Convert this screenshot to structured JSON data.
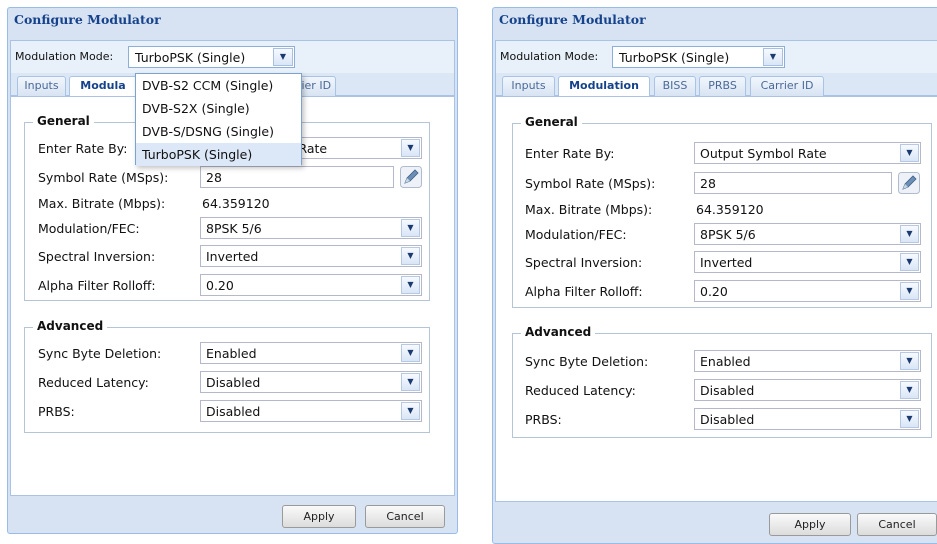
{
  "left": {
    "title": "Configure Modulator",
    "mode_label": "Modulation Mode:",
    "mode_value": "TurboPSK (Single)",
    "tabs": [
      {
        "label": "Inputs"
      },
      {
        "label": "Modula"
      },
      {
        "label": "rier ID"
      }
    ],
    "dropdown_options": [
      "DVB-S2 CCM (Single)",
      "DVB-S2X (Single)",
      "DVB-S/DSNG (Single)",
      "TurboPSK (Single)"
    ],
    "general_legend": "General",
    "enter_rate_label": "Enter Rate By:",
    "enter_rate_value": "l Rate",
    "symbol_rate_label": "Symbol Rate (MSps):",
    "symbol_rate_value": "28",
    "max_bitrate_label": "Max. Bitrate (Mbps):",
    "max_bitrate_value": "64.359120",
    "modfec_label": "Modulation/FEC:",
    "modfec_value": "8PSK 5/6",
    "spectral_label": "Spectral Inversion:",
    "spectral_value": "Inverted",
    "alpha_label": "Alpha Filter Rolloff:",
    "alpha_value": "0.20",
    "advanced_legend": "Advanced",
    "sync_label": "Sync Byte Deletion:",
    "sync_value": "Enabled",
    "latency_label": "Reduced Latency:",
    "latency_value": "Disabled",
    "prbs_label": "PRBS:",
    "prbs_value": "Disabled",
    "apply": "Apply",
    "cancel": "Cancel"
  },
  "right": {
    "title": "Configure Modulator",
    "mode_label": "Modulation Mode:",
    "mode_value": "TurboPSK (Single)",
    "tabs": [
      {
        "label": "Inputs"
      },
      {
        "label": "Modulation"
      },
      {
        "label": "BISS"
      },
      {
        "label": "PRBS"
      },
      {
        "label": "Carrier ID"
      }
    ],
    "general_legend": "General",
    "enter_rate_label": "Enter Rate By:",
    "enter_rate_value": "Output Symbol Rate",
    "symbol_rate_label": "Symbol Rate (MSps):",
    "symbol_rate_value": "28",
    "max_bitrate_label": "Max. Bitrate (Mbps):",
    "max_bitrate_value": "64.359120",
    "modfec_label": "Modulation/FEC:",
    "modfec_value": "8PSK 5/6",
    "spectral_label": "Spectral Inversion:",
    "spectral_value": "Inverted",
    "alpha_label": "Alpha Filter Rolloff:",
    "alpha_value": "0.20",
    "advanced_legend": "Advanced",
    "sync_label": "Sync Byte Deletion:",
    "sync_value": "Enabled",
    "latency_label": "Reduced Latency:",
    "latency_value": "Disabled",
    "prbs_label": "PRBS:",
    "prbs_value": "Disabled",
    "apply": "Apply",
    "cancel": "Cancel"
  }
}
